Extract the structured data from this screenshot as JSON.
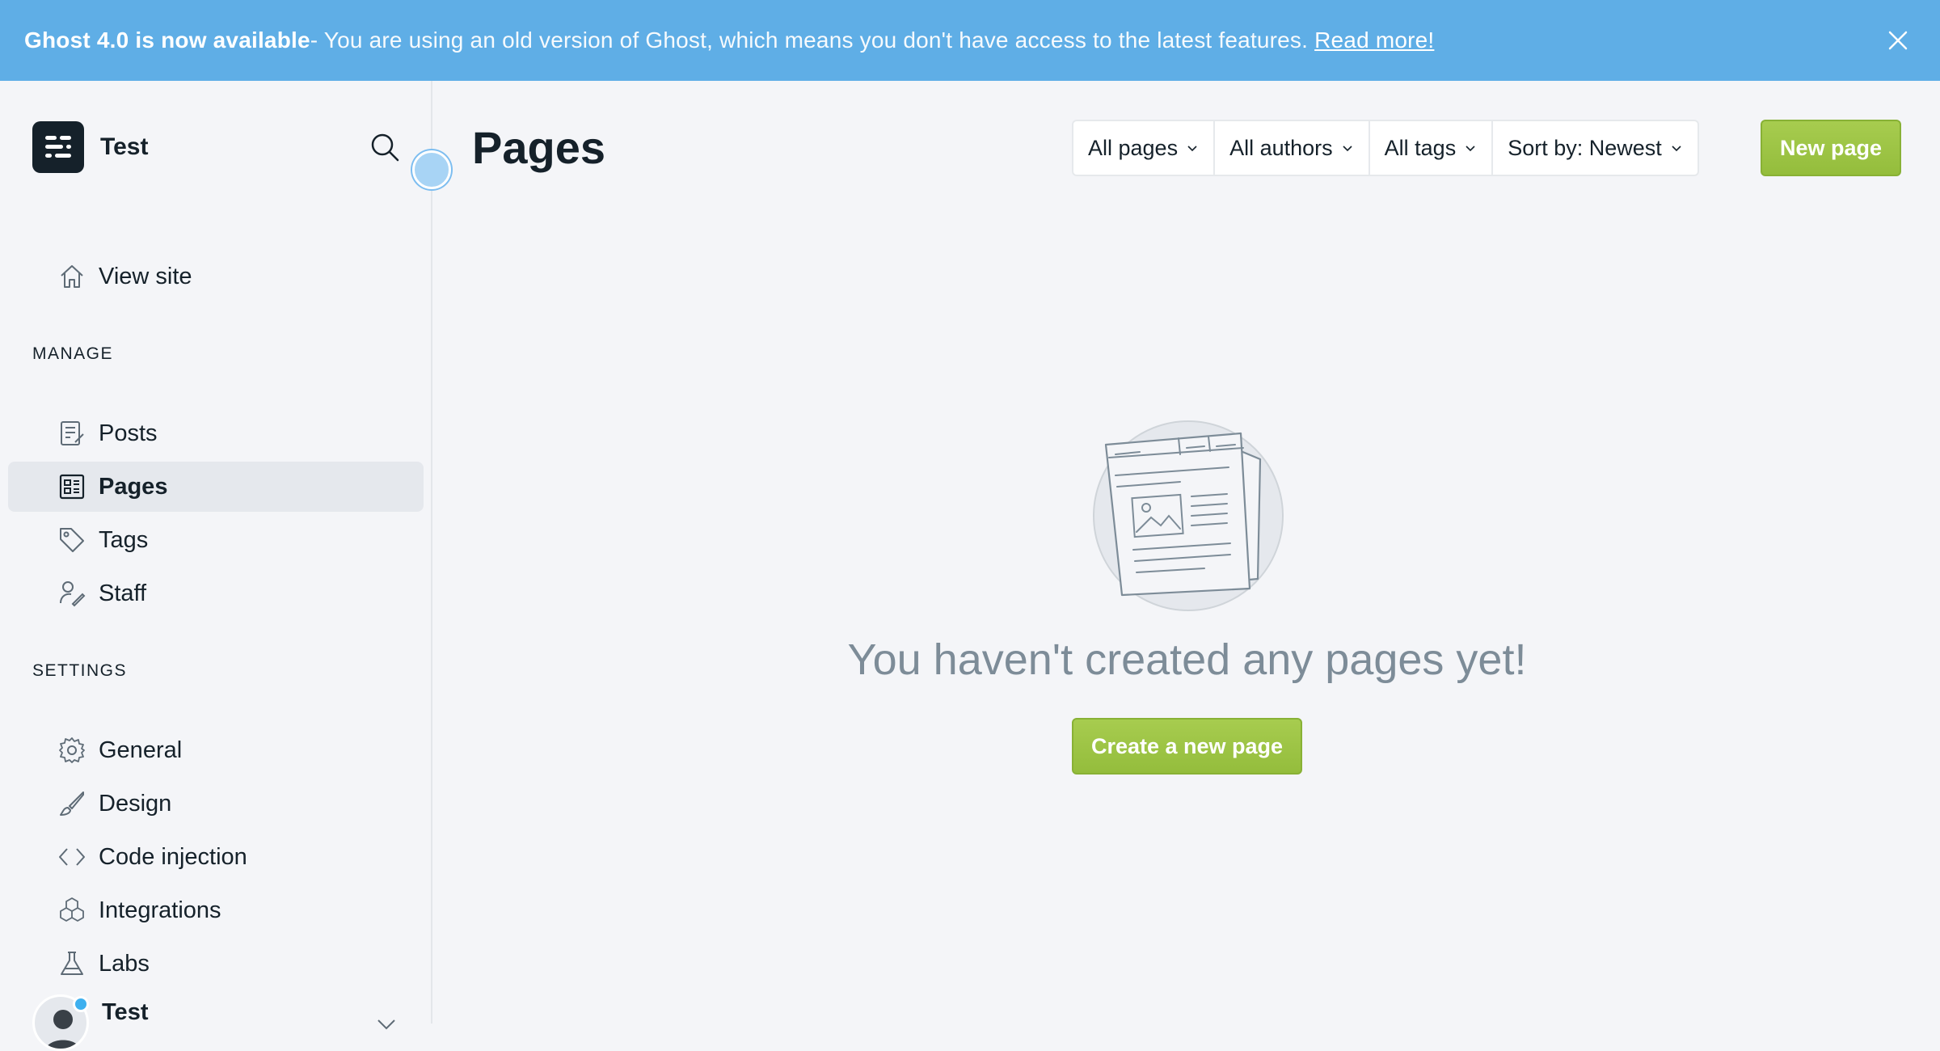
{
  "banner": {
    "strong": "Ghost 4.0 is now available",
    "message": " - You are using an old version of Ghost, which means you don't have access to the latest features.",
    "link": "Read more!",
    "close_icon": "close-icon"
  },
  "sidebar": {
    "brand_name": "Test",
    "brand_icon": "ghost-logo-icon",
    "search_icon": "search-icon",
    "view_site": {
      "label": "View site",
      "icon": "home-icon"
    },
    "manage_title": "MANAGE",
    "manage_items": [
      {
        "label": "Posts",
        "icon": "posts-icon"
      },
      {
        "label": "Pages",
        "icon": "pages-icon",
        "active": true
      },
      {
        "label": "Tags",
        "icon": "tag-icon"
      },
      {
        "label": "Staff",
        "icon": "staff-icon"
      }
    ],
    "settings_title": "SETTINGS",
    "settings_items": [
      {
        "label": "General",
        "icon": "gear-icon"
      },
      {
        "label": "Design",
        "icon": "brush-icon"
      },
      {
        "label": "Code injection",
        "icon": "code-icon"
      },
      {
        "label": "Integrations",
        "icon": "cubes-icon"
      },
      {
        "label": "Labs",
        "icon": "flask-icon"
      }
    ],
    "user": {
      "name": "Test"
    }
  },
  "main": {
    "title": "Pages",
    "filters": [
      {
        "label": "All pages"
      },
      {
        "label": "All authors"
      },
      {
        "label": "All tags"
      },
      {
        "label": "Sort by: Newest"
      }
    ],
    "new_page_label": "New page",
    "empty_message": "You haven't created any pages yet!",
    "create_label": "Create a new page"
  },
  "colors": {
    "banner": "#5faee6",
    "accent_green": "#9fc647",
    "sidebar_active": "#e5e8ed"
  }
}
